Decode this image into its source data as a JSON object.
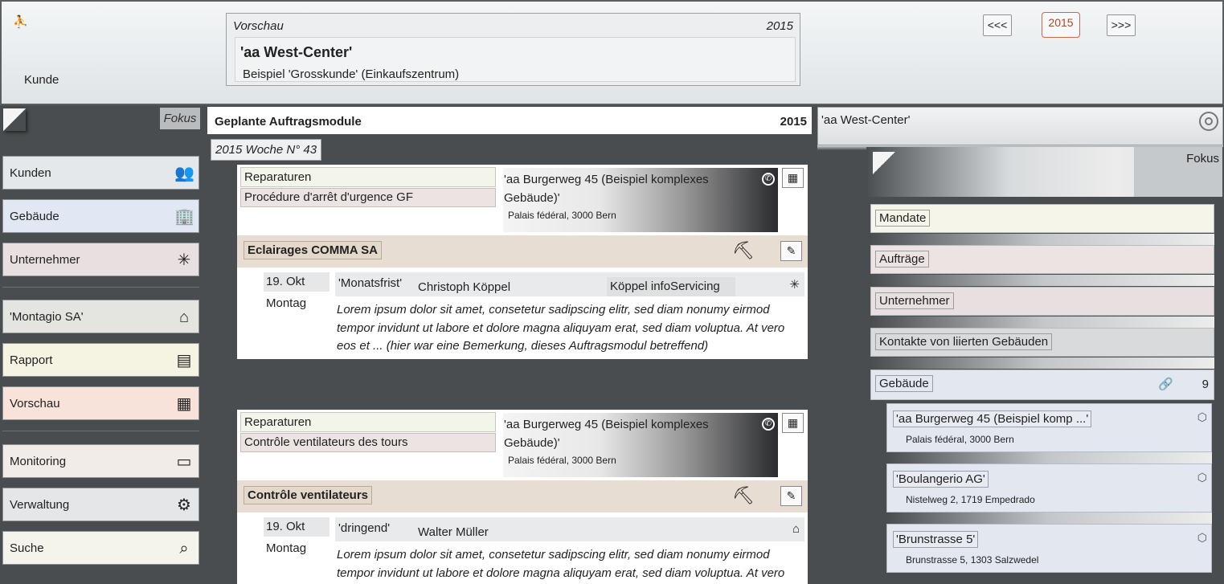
{
  "header": {
    "logo_glyph": "⛹",
    "kunde_label": "Kunde",
    "preview": {
      "title": "Vorschau",
      "year": "2015",
      "name": "'aa West-Center'",
      "description": "Beispiel 'Grosskunde' (Einkaufszentrum)"
    },
    "nav": {
      "prev": "<<<",
      "year": "2015",
      "next": ">>>"
    }
  },
  "left_nav": {
    "fokus": "Fokus",
    "items": [
      {
        "label": "Kunden",
        "icon": "users-icon",
        "glyph": "👥",
        "bg": "#e5e8ea"
      },
      {
        "label": "Gebäude",
        "icon": "buildings-icon",
        "glyph": "🏢",
        "bg": "#e1e8f3"
      },
      {
        "label": "Unternehmer",
        "icon": "network-icon",
        "glyph": "✳",
        "bg": "#e8e0e0"
      },
      {
        "label": "'Montagio SA'",
        "icon": "house-icon",
        "glyph": "⌂",
        "bg": "#e4e5e0"
      },
      {
        "label": "Rapport",
        "icon": "report-icon",
        "glyph": "▤",
        "bg": "#f5f3e2"
      },
      {
        "label": "Vorschau",
        "icon": "calendar-clock-icon",
        "glyph": "▦",
        "bg": "#f7e3da"
      },
      {
        "label": "Monitoring",
        "icon": "monitor-icon",
        "glyph": "▭",
        "bg": "#f2ece8"
      },
      {
        "label": "Verwaltung",
        "icon": "settings-doc-icon",
        "glyph": "⚙",
        "bg": "#e5e6e8"
      },
      {
        "label": "Suche",
        "icon": "search-icon",
        "glyph": "⌕",
        "bg": "#f4f4ec"
      }
    ]
  },
  "middle": {
    "title": "Geplante Auftragsmodule",
    "year": "2015",
    "week": "2015 Woche N° 43",
    "cards": [
      {
        "category": "Reparaturen",
        "procedure": "Procédure d'arrêt d'urgence GF",
        "building": "'aa Burgerweg 45 (Beispiel komplexes Gebäude)'",
        "address": "Palais fédéral, 3000 Bern",
        "firm": "Eclairages COMMA SA",
        "date": "19. Okt",
        "day": "Montag",
        "tag": "'Monatsfrist'",
        "person": "Christoph Köppel",
        "company": "Köppel infoServicing",
        "remark": "Lorem ipsum dolor sit amet, consetetur sadipscing elitr, sed diam nonumy eirmod tempor invidunt ut labore et dolore magna aliquyam erat, sed diam voluptua. At vero eos et ... (hier war eine Bemerkung, dieses Auftragsmodul betreffend)"
      },
      {
        "category": "Reparaturen",
        "procedure": "Contrôle ventilateurs des tours",
        "building": "'aa Burgerweg 45 (Beispiel komplexes Gebäude)'",
        "address": "Palais fédéral, 3000 Bern",
        "firm": "Contrôle ventilateurs",
        "date": "19. Okt",
        "day": "Montag",
        "tag": "'dringend'",
        "person": "Walter Müller",
        "company": "",
        "remark": "Lorem ipsum dolor sit amet, consetetur sadipscing elitr, sed diam nonumy eirmod tempor invidunt ut labore et dolore magna aliquyam erat, sed diam voluptua. At vero"
      }
    ]
  },
  "right": {
    "name": "'aa West-Center'",
    "fokus": "Fokus",
    "sections": [
      {
        "label": "Mandate",
        "bg": "#f5f5ea"
      },
      {
        "label": "Aufträge",
        "bg": "#ece3e3"
      },
      {
        "label": "Unternehmer",
        "bg": "#e8e0e0"
      },
      {
        "label": "Kontakte von liierten Gebäuden",
        "bg": "#d9dadb"
      },
      {
        "label": "Gebäude",
        "bg": "#e2e7f0",
        "count": "9"
      }
    ],
    "buildings": [
      {
        "name": "'aa Burgerweg 45 (Beispiel komp ...'",
        "address": "Palais fédéral, 3000 Bern"
      },
      {
        "name": "'Boulangerio AG'",
        "address": "Nistelweg 2, 1719 Empedrado"
      },
      {
        "name": "'Brunstrasse 5'",
        "address": "Brunstrasse 5, 1303 Salzwedel"
      }
    ]
  }
}
